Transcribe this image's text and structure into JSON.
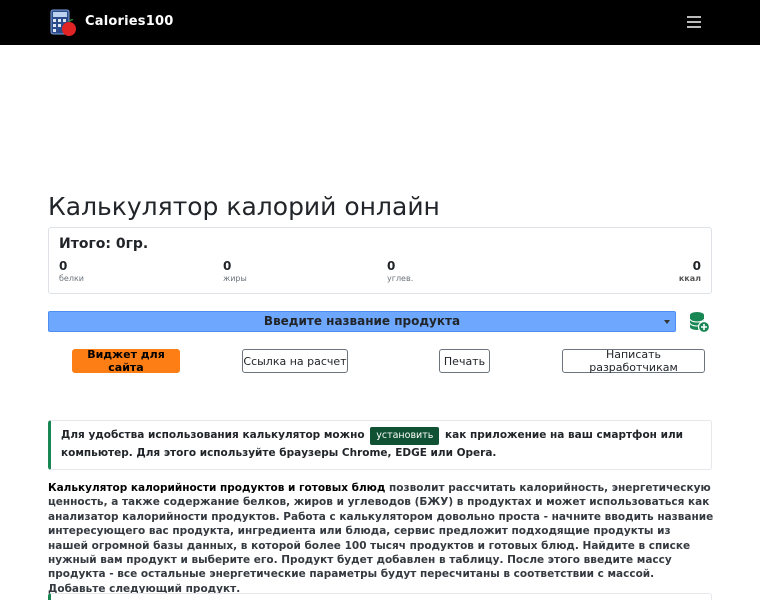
{
  "navbar": {
    "brand_name": "Calories100",
    "logo_icon": "calculator-apple-icon",
    "menu_icon": "hamburger-menu-icon"
  },
  "page": {
    "title": "Калькулятор калорий онлайн"
  },
  "totals": {
    "title": "Итого: 0гр.",
    "items": [
      {
        "value": "0",
        "label": "белки"
      },
      {
        "value": "0",
        "label": "жиры"
      },
      {
        "value": "0",
        "label": "углев."
      },
      {
        "value": "0",
        "label": "ккал"
      }
    ]
  },
  "search": {
    "placeholder": "Введите название продукта",
    "add_icon": "database-add-icon"
  },
  "actions": {
    "widget": "Виджет для сайта",
    "link": "Ссылка на расчет",
    "print": "Печать",
    "developers": "Написать разработчикам"
  },
  "install": {
    "before": "Для удобства использования калькулятор можно",
    "button": "установить",
    "after": "как приложение на ваш смартфон или компьютер. Для этого используйте браузеры Chrome, EDGE или Opera."
  },
  "description": {
    "strong": "Калькулятор калорийности продуктов и готовых блюд",
    "text": " позволит рассчитать калорийность, энергетическую ценность, а также содержание белков, жиров и углеводов (БЖУ) в продуктах и может использоваться как анализатор калорийности продуктов. Работа с калькулятором довольно проста - начните вводить название интересующего вас продукта, ингредиента или блюда, сервис предложит подходящие продукты из нашей огромной базы данных, в которой более 100 тысяч продуктов и готовых блюд. Найдите в списке нужный вам продукт и выберите его. Продукт будет добавлен в таблицу. После этого введите массу продукта - все остальные энергетические параметры будут пересчитаны в соответствии с массой. Добавьте следующий продукт."
  },
  "colors": {
    "navbar": "#000000",
    "select": "#6ea8fe",
    "widget_button": "#fd7e14",
    "install_accent": "#198754",
    "install_button": "#0f5132"
  }
}
